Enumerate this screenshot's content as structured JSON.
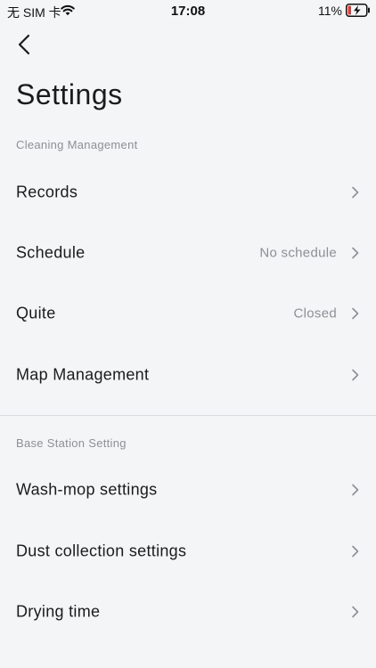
{
  "status_bar": {
    "carrier": "无 SIM 卡",
    "time": "17:08",
    "battery": "11%"
  },
  "header": {
    "back_icon": "chevron-left-icon",
    "title": "Settings"
  },
  "sections": [
    {
      "title": "Cleaning Management",
      "items": [
        {
          "label": "Records",
          "value": ""
        },
        {
          "label": "Schedule",
          "value": "No schedule"
        },
        {
          "label": "Quite",
          "value": "Closed"
        },
        {
          "label": "Map Management",
          "value": ""
        }
      ]
    },
    {
      "title": "Base Station Setting",
      "items": [
        {
          "label": "Wash-mop settings",
          "value": ""
        },
        {
          "label": "Dust collection settings",
          "value": ""
        },
        {
          "label": "Drying time",
          "value": ""
        }
      ]
    }
  ],
  "colors": {
    "background": "#f4f5f7",
    "text": "#1b1b1d",
    "secondary_text": "#8d8f95",
    "battery_low": "#e53935"
  }
}
